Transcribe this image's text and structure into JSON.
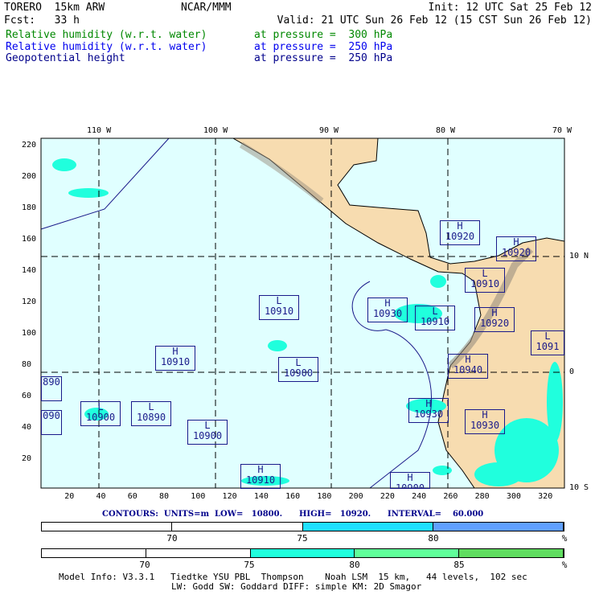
{
  "header": {
    "model": "TORERO  15km ARW",
    "org": "NCAR/MMM",
    "init": "Init: 12 UTC Sat 25 Feb 12",
    "fcst": "Fcst:   33 h",
    "valid": "Valid: 21 UTC Sun 26 Feb 12 (15 CST Sun 26 Feb 12)",
    "fields": [
      {
        "name": "Relative humidity (w.r.t. water)",
        "level": "at pressure =  300 hPa",
        "color": "#008800"
      },
      {
        "name": "Relative humidity (w.r.t. water)",
        "level": "at pressure =  250 hPa",
        "color": "#0000ee"
      },
      {
        "name": "Geopotential height",
        "level": "at pressure =  250 hPa",
        "color": "#00008b"
      }
    ]
  },
  "map": {
    "lon_labels": [
      "110 W",
      "100 W",
      "90 W",
      "80 W",
      "70 W"
    ],
    "lat_labels": [
      "10 N",
      "0",
      "10 S"
    ],
    "x_ticks": [
      "20",
      "40",
      "60",
      "80",
      "100",
      "120",
      "140",
      "160",
      "180",
      "200",
      "220",
      "240",
      "260",
      "280",
      "300",
      "320"
    ],
    "y_ticks": [
      "20",
      "40",
      "60",
      "80",
      "100",
      "120",
      "140",
      "160",
      "180",
      "200",
      "220"
    ],
    "centers": [
      {
        "type": "H",
        "value": "10920"
      },
      {
        "type": "H",
        "value": "10920"
      },
      {
        "type": "L",
        "value": "10910"
      },
      {
        "type": "H",
        "value": "10930"
      },
      {
        "type": "L",
        "value": "10910"
      },
      {
        "type": "H",
        "value": "10920"
      },
      {
        "type": "L",
        "value": "10910"
      },
      {
        "type": "L",
        "value": "1091"
      },
      {
        "type": "H",
        "value": "10940"
      },
      {
        "type": "L",
        "value": "10900"
      },
      {
        "type": "H",
        "value": "10910"
      },
      {
        "type": "H",
        "value": "10930"
      },
      {
        "type": "H",
        "value": "10930"
      },
      {
        "type": "L",
        "value": "10900"
      },
      {
        "type": "L",
        "value": "10890"
      },
      {
        "type": "L",
        "value": "10900"
      },
      {
        "type": "H",
        "value": "10910"
      },
      {
        "type": "H",
        "value": "10900"
      },
      {
        "type": "",
        "value": "890"
      },
      {
        "type": "",
        "value": "090"
      }
    ],
    "colors": {
      "ocean": "#e0ffff",
      "land": "#f7dcb0",
      "rh300": "#20ffdd",
      "rh250": "#20e0ff"
    }
  },
  "contours": "CONTOURS:  UNITS=m  LOW=   10800.      HIGH=   10920.      INTERVAL=    60.000",
  "legend1": {
    "labels": [
      "70",
      "75",
      "80",
      "%"
    ],
    "colors": [
      "#ffffff",
      "#ffffff",
      "#20e0ff",
      "#60a0ff"
    ]
  },
  "legend2": {
    "labels": [
      "70",
      "75",
      "80",
      "85",
      "%"
    ],
    "colors": [
      "#ffffff",
      "#ffffff",
      "#20ffdd",
      "#60ff9a",
      "#60dd60"
    ]
  },
  "footer": {
    "line1": "Model Info: V3.3.1   Tiedtke YSU PBL  Thompson    Noah LSM  15 km,   44 levels,  102 sec",
    "line2": "LW: Godd SW: Goddard DIFF: simple KM: 2D Smagor"
  }
}
